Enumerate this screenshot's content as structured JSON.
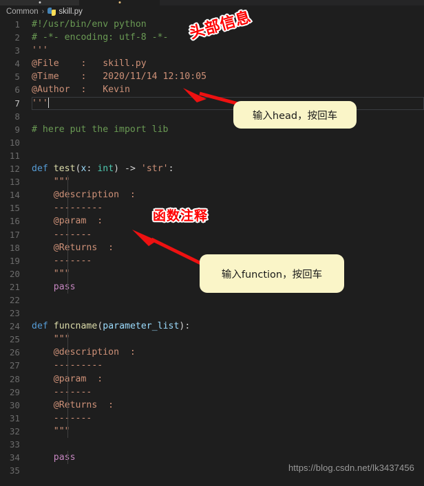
{
  "window": {
    "background_color": "#1e1e1e",
    "tabs": [
      {
        "name": "tab-left",
        "active": false,
        "width": 115,
        "dot_color": "#cccccc"
      },
      {
        "name": "tab-right",
        "active": true,
        "width": 117,
        "dot_color": "#e8c07d"
      }
    ]
  },
  "breadcrumb": {
    "folder": "Common",
    "separator": "›",
    "file_icon": "python-icon",
    "filename": "skill.py"
  },
  "editor": {
    "language": "python",
    "current_line": 7,
    "lines": [
      {
        "n": "1",
        "tokens": [
          {
            "t": "#!/usr/bin/env python",
            "c": "c-com",
            "ind": 0
          }
        ]
      },
      {
        "n": "2",
        "tokens": [
          {
            "t": "# -*- encoding: utf-8 -*-",
            "c": "c-com",
            "ind": 0
          }
        ]
      },
      {
        "n": "3",
        "tokens": [
          {
            "t": "'''",
            "c": "c-str",
            "ind": 0
          }
        ]
      },
      {
        "n": "4",
        "tokens": [
          {
            "t": "@File    :   skill.py",
            "c": "c-str",
            "ind": 0
          }
        ]
      },
      {
        "n": "5",
        "tokens": [
          {
            "t": "@Time    :   2020/11/14 12:10:05",
            "c": "c-str",
            "ind": 0
          }
        ]
      },
      {
        "n": "6",
        "tokens": [
          {
            "t": "@Author  :   Kevin",
            "c": "c-str",
            "ind": 0
          }
        ]
      },
      {
        "n": "7",
        "tokens": [
          {
            "t": "'''",
            "c": "c-str",
            "ind": 0
          }
        ],
        "caret": true
      },
      {
        "n": "8",
        "tokens": []
      },
      {
        "n": "9",
        "tokens": [
          {
            "t": "# here put the import lib",
            "c": "c-com",
            "ind": 0
          }
        ]
      },
      {
        "n": "10",
        "tokens": []
      },
      {
        "n": "11",
        "tokens": []
      },
      {
        "n": "12",
        "tokens": [
          {
            "t": "def",
            "c": "c-kw"
          },
          {
            "t": " ",
            "c": "c-pl"
          },
          {
            "t": "test",
            "c": "c-fn"
          },
          {
            "t": "(",
            "c": "c-pl"
          },
          {
            "t": "x",
            "c": "c-var"
          },
          {
            "t": ": ",
            "c": "c-pl"
          },
          {
            "t": "int",
            "c": "c-typ"
          },
          {
            "t": ") -> ",
            "c": "c-pl"
          },
          {
            "t": "'str'",
            "c": "c-str"
          },
          {
            "t": ":",
            "c": "c-pl"
          }
        ]
      },
      {
        "n": "13",
        "tokens": [
          {
            "t": "    \"\"\"",
            "c": "c-str"
          }
        ],
        "guide": true
      },
      {
        "n": "14",
        "tokens": [
          {
            "t": "    @description  :",
            "c": "c-str"
          }
        ],
        "guide": true
      },
      {
        "n": "15",
        "tokens": [
          {
            "t": "    ---------",
            "c": "c-str"
          }
        ],
        "guide": true
      },
      {
        "n": "16",
        "tokens": [
          {
            "t": "    @param  :",
            "c": "c-str"
          }
        ],
        "guide": true
      },
      {
        "n": "17",
        "tokens": [
          {
            "t": "    -------",
            "c": "c-str"
          }
        ],
        "guide": true
      },
      {
        "n": "18",
        "tokens": [
          {
            "t": "    @Returns  :",
            "c": "c-str"
          }
        ],
        "guide": true
      },
      {
        "n": "19",
        "tokens": [
          {
            "t": "    -------",
            "c": "c-str"
          }
        ],
        "guide": true
      },
      {
        "n": "20",
        "tokens": [
          {
            "t": "    \"\"\"",
            "c": "c-str"
          }
        ],
        "guide": true
      },
      {
        "n": "21",
        "tokens": [
          {
            "t": "    ",
            "c": "c-pl"
          },
          {
            "t": "pass",
            "c": "c-ctl"
          }
        ],
        "guide": true
      },
      {
        "n": "22",
        "tokens": []
      },
      {
        "n": "23",
        "tokens": []
      },
      {
        "n": "24",
        "tokens": [
          {
            "t": "def",
            "c": "c-kw"
          },
          {
            "t": " ",
            "c": "c-pl"
          },
          {
            "t": "funcname",
            "c": "c-fn"
          },
          {
            "t": "(",
            "c": "c-pl"
          },
          {
            "t": "parameter_list",
            "c": "c-var"
          },
          {
            "t": "):",
            "c": "c-pl"
          }
        ]
      },
      {
        "n": "25",
        "tokens": [
          {
            "t": "    \"\"\"",
            "c": "c-str"
          }
        ],
        "guide": true
      },
      {
        "n": "26",
        "tokens": [
          {
            "t": "    @description  :",
            "c": "c-str"
          }
        ],
        "guide": true
      },
      {
        "n": "27",
        "tokens": [
          {
            "t": "    ---------",
            "c": "c-str"
          }
        ],
        "guide": true
      },
      {
        "n": "28",
        "tokens": [
          {
            "t": "    @param  :",
            "c": "c-str"
          }
        ],
        "guide": true
      },
      {
        "n": "29",
        "tokens": [
          {
            "t": "    -------",
            "c": "c-str"
          }
        ],
        "guide": true
      },
      {
        "n": "30",
        "tokens": [
          {
            "t": "    @Returns  :",
            "c": "c-str"
          }
        ],
        "guide": true
      },
      {
        "n": "31",
        "tokens": [
          {
            "t": "    -------",
            "c": "c-str"
          }
        ],
        "guide": true
      },
      {
        "n": "32",
        "tokens": [
          {
            "t": "    \"\"\"",
            "c": "c-str"
          }
        ],
        "guide": true
      },
      {
        "n": "33",
        "tokens": [],
        "guide": true
      },
      {
        "n": "34",
        "tokens": [
          {
            "t": "    ",
            "c": "c-pl"
          },
          {
            "t": "pass",
            "c": "c-ctl"
          }
        ],
        "guide": true
      },
      {
        "n": "35",
        "tokens": []
      }
    ]
  },
  "annotations": {
    "label_color": "#ff0000",
    "tip_background": "#faf5c8",
    "arrow_color": "#ee1111",
    "head_label": "头部信息",
    "func_label": "函数注释",
    "head_tip": "输入head，按回车",
    "func_tip": "输入function，按回车"
  },
  "watermark": {
    "text": "https://blog.csdn.net/lk3437456"
  }
}
